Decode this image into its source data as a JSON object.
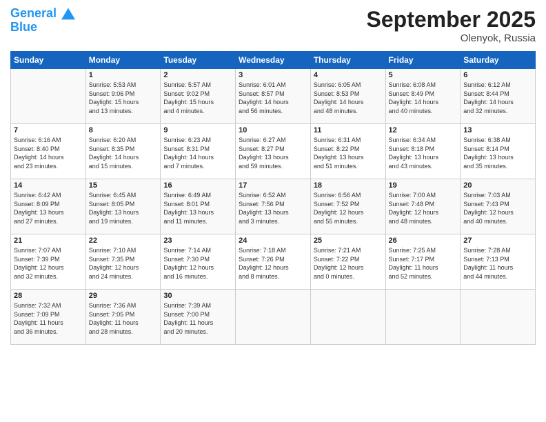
{
  "header": {
    "logo_line1": "General",
    "logo_line2": "Blue",
    "month": "September 2025",
    "location": "Olenyok, Russia"
  },
  "weekdays": [
    "Sunday",
    "Monday",
    "Tuesday",
    "Wednesday",
    "Thursday",
    "Friday",
    "Saturday"
  ],
  "weeks": [
    [
      {
        "day": "",
        "info": ""
      },
      {
        "day": "1",
        "info": "Sunrise: 5:53 AM\nSunset: 9:06 PM\nDaylight: 15 hours\nand 13 minutes."
      },
      {
        "day": "2",
        "info": "Sunrise: 5:57 AM\nSunset: 9:02 PM\nDaylight: 15 hours\nand 4 minutes."
      },
      {
        "day": "3",
        "info": "Sunrise: 6:01 AM\nSunset: 8:57 PM\nDaylight: 14 hours\nand 56 minutes."
      },
      {
        "day": "4",
        "info": "Sunrise: 6:05 AM\nSunset: 8:53 PM\nDaylight: 14 hours\nand 48 minutes."
      },
      {
        "day": "5",
        "info": "Sunrise: 6:08 AM\nSunset: 8:49 PM\nDaylight: 14 hours\nand 40 minutes."
      },
      {
        "day": "6",
        "info": "Sunrise: 6:12 AM\nSunset: 8:44 PM\nDaylight: 14 hours\nand 32 minutes."
      }
    ],
    [
      {
        "day": "7",
        "info": "Sunrise: 6:16 AM\nSunset: 8:40 PM\nDaylight: 14 hours\nand 23 minutes."
      },
      {
        "day": "8",
        "info": "Sunrise: 6:20 AM\nSunset: 8:35 PM\nDaylight: 14 hours\nand 15 minutes."
      },
      {
        "day": "9",
        "info": "Sunrise: 6:23 AM\nSunset: 8:31 PM\nDaylight: 14 hours\nand 7 minutes."
      },
      {
        "day": "10",
        "info": "Sunrise: 6:27 AM\nSunset: 8:27 PM\nDaylight: 13 hours\nand 59 minutes."
      },
      {
        "day": "11",
        "info": "Sunrise: 6:31 AM\nSunset: 8:22 PM\nDaylight: 13 hours\nand 51 minutes."
      },
      {
        "day": "12",
        "info": "Sunrise: 6:34 AM\nSunset: 8:18 PM\nDaylight: 13 hours\nand 43 minutes."
      },
      {
        "day": "13",
        "info": "Sunrise: 6:38 AM\nSunset: 8:14 PM\nDaylight: 13 hours\nand 35 minutes."
      }
    ],
    [
      {
        "day": "14",
        "info": "Sunrise: 6:42 AM\nSunset: 8:09 PM\nDaylight: 13 hours\nand 27 minutes."
      },
      {
        "day": "15",
        "info": "Sunrise: 6:45 AM\nSunset: 8:05 PM\nDaylight: 13 hours\nand 19 minutes."
      },
      {
        "day": "16",
        "info": "Sunrise: 6:49 AM\nSunset: 8:01 PM\nDaylight: 13 hours\nand 11 minutes."
      },
      {
        "day": "17",
        "info": "Sunrise: 6:52 AM\nSunset: 7:56 PM\nDaylight: 13 hours\nand 3 minutes."
      },
      {
        "day": "18",
        "info": "Sunrise: 6:56 AM\nSunset: 7:52 PM\nDaylight: 12 hours\nand 55 minutes."
      },
      {
        "day": "19",
        "info": "Sunrise: 7:00 AM\nSunset: 7:48 PM\nDaylight: 12 hours\nand 48 minutes."
      },
      {
        "day": "20",
        "info": "Sunrise: 7:03 AM\nSunset: 7:43 PM\nDaylight: 12 hours\nand 40 minutes."
      }
    ],
    [
      {
        "day": "21",
        "info": "Sunrise: 7:07 AM\nSunset: 7:39 PM\nDaylight: 12 hours\nand 32 minutes."
      },
      {
        "day": "22",
        "info": "Sunrise: 7:10 AM\nSunset: 7:35 PM\nDaylight: 12 hours\nand 24 minutes."
      },
      {
        "day": "23",
        "info": "Sunrise: 7:14 AM\nSunset: 7:30 PM\nDaylight: 12 hours\nand 16 minutes."
      },
      {
        "day": "24",
        "info": "Sunrise: 7:18 AM\nSunset: 7:26 PM\nDaylight: 12 hours\nand 8 minutes."
      },
      {
        "day": "25",
        "info": "Sunrise: 7:21 AM\nSunset: 7:22 PM\nDaylight: 12 hours\nand 0 minutes."
      },
      {
        "day": "26",
        "info": "Sunrise: 7:25 AM\nSunset: 7:17 PM\nDaylight: 11 hours\nand 52 minutes."
      },
      {
        "day": "27",
        "info": "Sunrise: 7:28 AM\nSunset: 7:13 PM\nDaylight: 11 hours\nand 44 minutes."
      }
    ],
    [
      {
        "day": "28",
        "info": "Sunrise: 7:32 AM\nSunset: 7:09 PM\nDaylight: 11 hours\nand 36 minutes."
      },
      {
        "day": "29",
        "info": "Sunrise: 7:36 AM\nSunset: 7:05 PM\nDaylight: 11 hours\nand 28 minutes."
      },
      {
        "day": "30",
        "info": "Sunrise: 7:39 AM\nSunset: 7:00 PM\nDaylight: 11 hours\nand 20 minutes."
      },
      {
        "day": "",
        "info": ""
      },
      {
        "day": "",
        "info": ""
      },
      {
        "day": "",
        "info": ""
      },
      {
        "day": "",
        "info": ""
      }
    ]
  ]
}
